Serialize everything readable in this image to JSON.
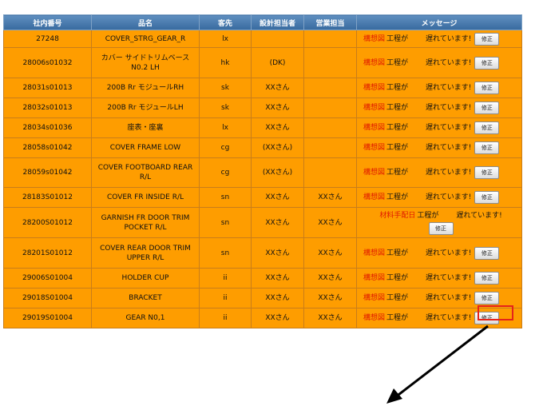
{
  "table": {
    "headers": [
      "社内番号",
      "品名",
      "客先",
      "設計担当者",
      "営業担当",
      "メッセージ"
    ],
    "rows": [
      {
        "part_no": "27248",
        "name": "COVER_STRG_GEAR_R",
        "customer": "lx",
        "designer": "",
        "sales": "",
        "message": "構想図|工程が|遅れています!",
        "button": "修正"
      },
      {
        "part_no": "28006s01032",
        "name": "カバー サイドトリムベース N0.2 LH",
        "customer": "hk",
        "designer": "(DK)",
        "sales": "",
        "message": "構想図|工程が|遅れています!",
        "button": "修正"
      },
      {
        "part_no": "28031s01013",
        "name": "200B Rr モジュールRH",
        "customer": "sk",
        "designer": "XXさん",
        "sales": "",
        "message": "構想図|工程が|遅れています!",
        "button": "修正"
      },
      {
        "part_no": "28032s01013",
        "name": "200B Rr モジュールLH",
        "customer": "sk",
        "designer": "XXさん",
        "sales": "",
        "message": "構想図|工程が|遅れています!",
        "button": "修正"
      },
      {
        "part_no": "28034s01036",
        "name": "座表・座裏",
        "customer": "lx",
        "designer": "XXさん",
        "sales": "",
        "message": "構想図|工程が|遅れています!",
        "button": "修正"
      },
      {
        "part_no": "28058s01042",
        "name": "COVER FRAME LOW",
        "customer": "cg",
        "designer": "(XXさん)",
        "sales": "",
        "message": "構想図|工程が|遅れています!",
        "button": "修正"
      },
      {
        "part_no": "28059s01042",
        "name": "COVER FOOTBOARD REAR R/L",
        "customer": "cg",
        "designer": "(XXさん)",
        "sales": "",
        "message": "構想図|工程が|遅れています!",
        "button": "修正"
      },
      {
        "part_no": "28183S01012",
        "name": "COVER FR INSIDE R/L",
        "customer": "sn",
        "designer": "XXさん",
        "sales": "XXさん",
        "message": "構想図|工程が|遅れています!",
        "button": "修正"
      },
      {
        "part_no": "28200S01012",
        "name": "GARNISH FR DOOR TRIM POCKET R/L",
        "customer": "sn",
        "designer": "XXさん",
        "sales": "XXさん",
        "message": "材料手配日|工程が|遅れています!",
        "button": "修正"
      },
      {
        "part_no": "28201S01012",
        "name": "COVER REAR DOOR TRIM UPPER R/L",
        "customer": "sn",
        "designer": "XXさん",
        "sales": "XXさん",
        "message": "構想図|工程が|遅れています!",
        "button": "修正"
      },
      {
        "part_no": "29006S01004",
        "name": "HOLDER CUP",
        "customer": "ii",
        "designer": "XXさん",
        "sales": "XXさん",
        "message": "構想図|工程が|遅れています!",
        "button": "修正"
      },
      {
        "part_no": "29018S01004",
        "name": "BRACKET",
        "customer": "ii",
        "designer": "XXさん",
        "sales": "XXさん",
        "message": "構想図|工程が|遅れています!",
        "button": "修正"
      },
      {
        "part_no": "29019S01004",
        "name": "GEAR N0,1",
        "customer": "ii",
        "designer": "XXさん",
        "sales": "XXさん",
        "message": "構想図|工程が|遅れています!",
        "button": "修正"
      }
    ]
  },
  "colors": {
    "header_bg": "#4a7cb0",
    "row_bg": "#fe9d00",
    "accent_red": "#e01a00",
    "highlight": "#e5231b"
  },
  "annotation": {
    "highlight_row": 12,
    "arrow_icon": "arrow-down-left-icon"
  }
}
